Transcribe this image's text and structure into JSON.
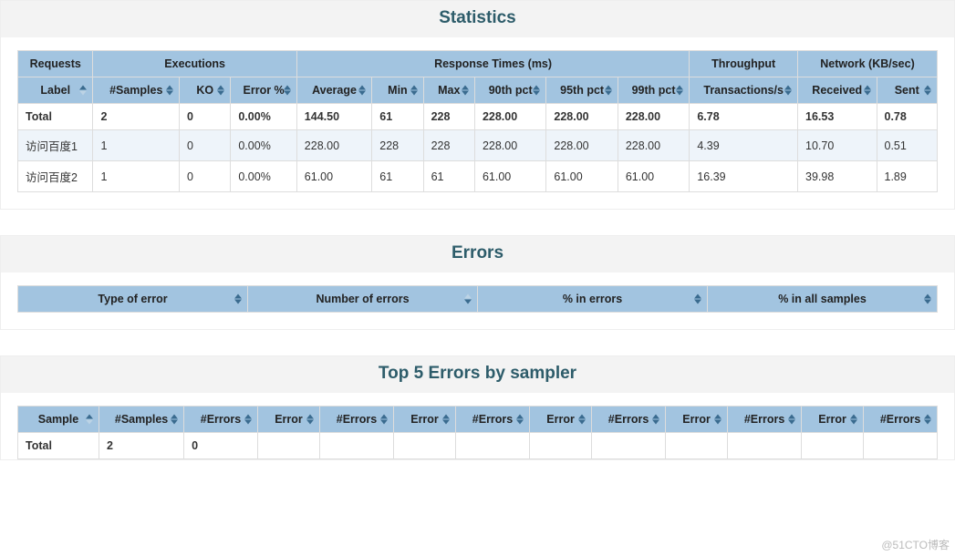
{
  "watermark": "@51CTO博客",
  "statistics": {
    "title": "Statistics",
    "group_headers": {
      "requests": "Requests",
      "executions": "Executions",
      "response_times": "Response Times (ms)",
      "throughput": "Throughput",
      "network": "Network (KB/sec)"
    },
    "columns": {
      "label": "Label",
      "samples": "#Samples",
      "ko": "KO",
      "error_pct": "Error %",
      "average": "Average",
      "min": "Min",
      "max": "Max",
      "pct90": "90th pct",
      "pct95": "95th pct",
      "pct99": "99th pct",
      "tps": "Transactions/s",
      "received": "Received",
      "sent": "Sent"
    },
    "rows": [
      {
        "label": "Total",
        "samples": "2",
        "ko": "0",
        "error_pct": "0.00%",
        "average": "144.50",
        "min": "61",
        "max": "228",
        "pct90": "228.00",
        "pct95": "228.00",
        "pct99": "228.00",
        "tps": "6.78",
        "received": "16.53",
        "sent": "0.78",
        "is_total": true
      },
      {
        "label": "访问百度1",
        "samples": "1",
        "ko": "0",
        "error_pct": "0.00%",
        "average": "228.00",
        "min": "228",
        "max": "228",
        "pct90": "228.00",
        "pct95": "228.00",
        "pct99": "228.00",
        "tps": "4.39",
        "received": "10.70",
        "sent": "0.51",
        "is_total": false
      },
      {
        "label": "访问百度2",
        "samples": "1",
        "ko": "0",
        "error_pct": "0.00%",
        "average": "61.00",
        "min": "61",
        "max": "61",
        "pct90": "61.00",
        "pct95": "61.00",
        "pct99": "61.00",
        "tps": "16.39",
        "received": "39.98",
        "sent": "1.89",
        "is_total": false
      }
    ]
  },
  "errors": {
    "title": "Errors",
    "columns": {
      "type": "Type of error",
      "number": "Number of errors",
      "pct_errors": "% in errors",
      "pct_samples": "% in all samples"
    },
    "rows": []
  },
  "top5": {
    "title": "Top 5 Errors by sampler",
    "columns": {
      "sample": "Sample",
      "samples": "#Samples",
      "errors": "#Errors",
      "error": "Error",
      "nerrors": "#Errors"
    },
    "rows": [
      {
        "sample": "Total",
        "samples": "2",
        "errors": "0",
        "e1": "",
        "n1": "",
        "e2": "",
        "n2": "",
        "e3": "",
        "n3": "",
        "e4": "",
        "n4": "",
        "e5": "",
        "n5": "",
        "is_total": true
      }
    ]
  }
}
